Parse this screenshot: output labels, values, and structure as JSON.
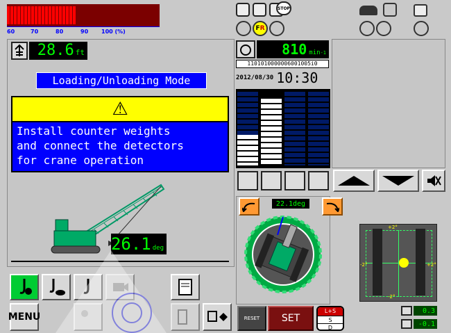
{
  "load_bar": {
    "scale_labels": [
      "60",
      "70",
      "80",
      "90",
      "100 (%)"
    ],
    "lit_segments": 20,
    "total_segments": 43,
    "bar_color": "#ff0000"
  },
  "signals": {
    "f_label": "F",
    "r_label": "R",
    "stop_label": "STOP"
  },
  "boom": {
    "length_value": "28.6",
    "length_unit": "ft"
  },
  "mode_label": "Loading/Unloading Mode",
  "warning": {
    "symbol": "⚠",
    "lines": [
      "Install counter weights",
      "and connect the detectors",
      "for crane operation"
    ]
  },
  "engine": {
    "rpm_value": "810",
    "rpm_unit": "min",
    "rpm_exp": "-1",
    "bit_code": "1101010000006001005i0",
    "date": "2012/08/30",
    "time": "10:30"
  },
  "boom_angle": {
    "value": "26.1",
    "unit": "deg"
  },
  "swing": {
    "angle_readout": "22.1deg"
  },
  "level": {
    "tick_plus_top": "+2°",
    "tick_minus_left": "-2°",
    "tick_plus_right": "+2°",
    "tick_minus_bottom": "-2°",
    "x_value": "0.3",
    "y_value": "-0.1"
  },
  "buttons": {
    "menu": "MENU",
    "reset": "RESET",
    "set": "SET",
    "ls": "L+S",
    "s": "S",
    "d": "D"
  },
  "colors": {
    "accent_green": "#00cc66",
    "lcd_green": "#00ff00",
    "warning_yellow": "#ffff00",
    "warning_blue": "#0000ff",
    "orange": "#ff9933"
  }
}
